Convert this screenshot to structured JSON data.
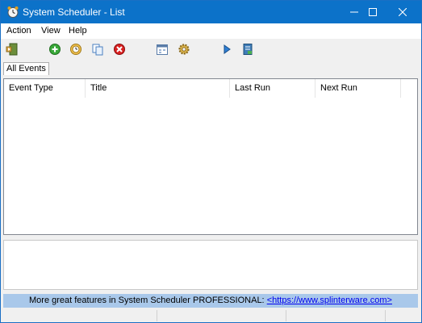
{
  "window": {
    "title": "System Scheduler - List",
    "controls": {
      "minimize": "minimize-icon",
      "maximize": "maximize-icon",
      "close": "close-icon"
    }
  },
  "menu": {
    "items": [
      "Action",
      "View",
      "Help"
    ]
  },
  "toolbar": {
    "buttons": [
      "exit-icon",
      "add-event-icon",
      "edit-event-icon",
      "copy-event-icon",
      "delete-event-icon",
      "calendar-view-icon",
      "settings-icon",
      "run-icon",
      "log-icon"
    ]
  },
  "tabs": {
    "active": "All Events"
  },
  "list": {
    "columns": [
      "Event Type",
      "Title",
      "Last Run",
      "Next Run"
    ],
    "rows": []
  },
  "promo": {
    "text": "More great features in System Scheduler PROFESSIONAL: ",
    "link": "<https://www.splinterware.com>"
  },
  "colors": {
    "titlebar": "#0c72c9",
    "promo_band": "#a9c8ea",
    "link": "#0000ee"
  }
}
